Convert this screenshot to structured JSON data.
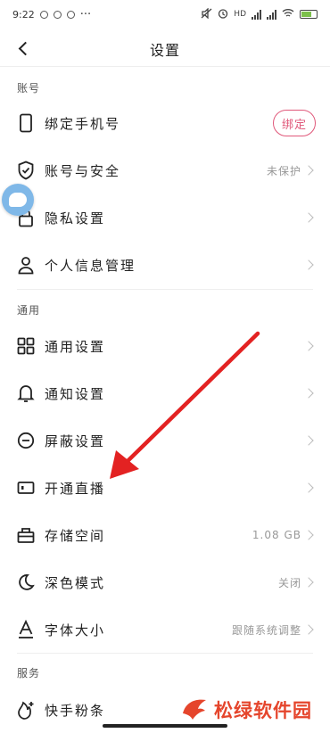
{
  "status_bar": {
    "time": "9:22",
    "more": "···",
    "network": "HD"
  },
  "header": {
    "title": "设置"
  },
  "sections": {
    "account": {
      "title": "账号"
    },
    "general": {
      "title": "通用"
    },
    "service": {
      "title": "服务"
    }
  },
  "rows": {
    "bind_phone": {
      "label": "绑定手机号",
      "button": "绑定"
    },
    "account_security": {
      "label": "账号与安全",
      "value": "未保护"
    },
    "privacy": {
      "label": "隐私设置"
    },
    "personal_info": {
      "label": "个人信息管理"
    },
    "general_settings": {
      "label": "通用设置"
    },
    "notification": {
      "label": "通知设置"
    },
    "block": {
      "label": "屏蔽设置"
    },
    "live": {
      "label": "开通直播"
    },
    "storage": {
      "label": "存储空间",
      "value": "1.08 GB"
    },
    "dark_mode": {
      "label": "深色模式",
      "value": "关闭"
    },
    "font_size": {
      "label": "字体大小",
      "value": "跟随系统调整"
    },
    "fans": {
      "label": "快手粉条"
    }
  },
  "watermark": {
    "text": "松绿软件园"
  },
  "colors": {
    "accent": "#e0587a",
    "arrow": "#e32222",
    "watermark": "#e5452c",
    "bubble": "#7fb8e8"
  }
}
